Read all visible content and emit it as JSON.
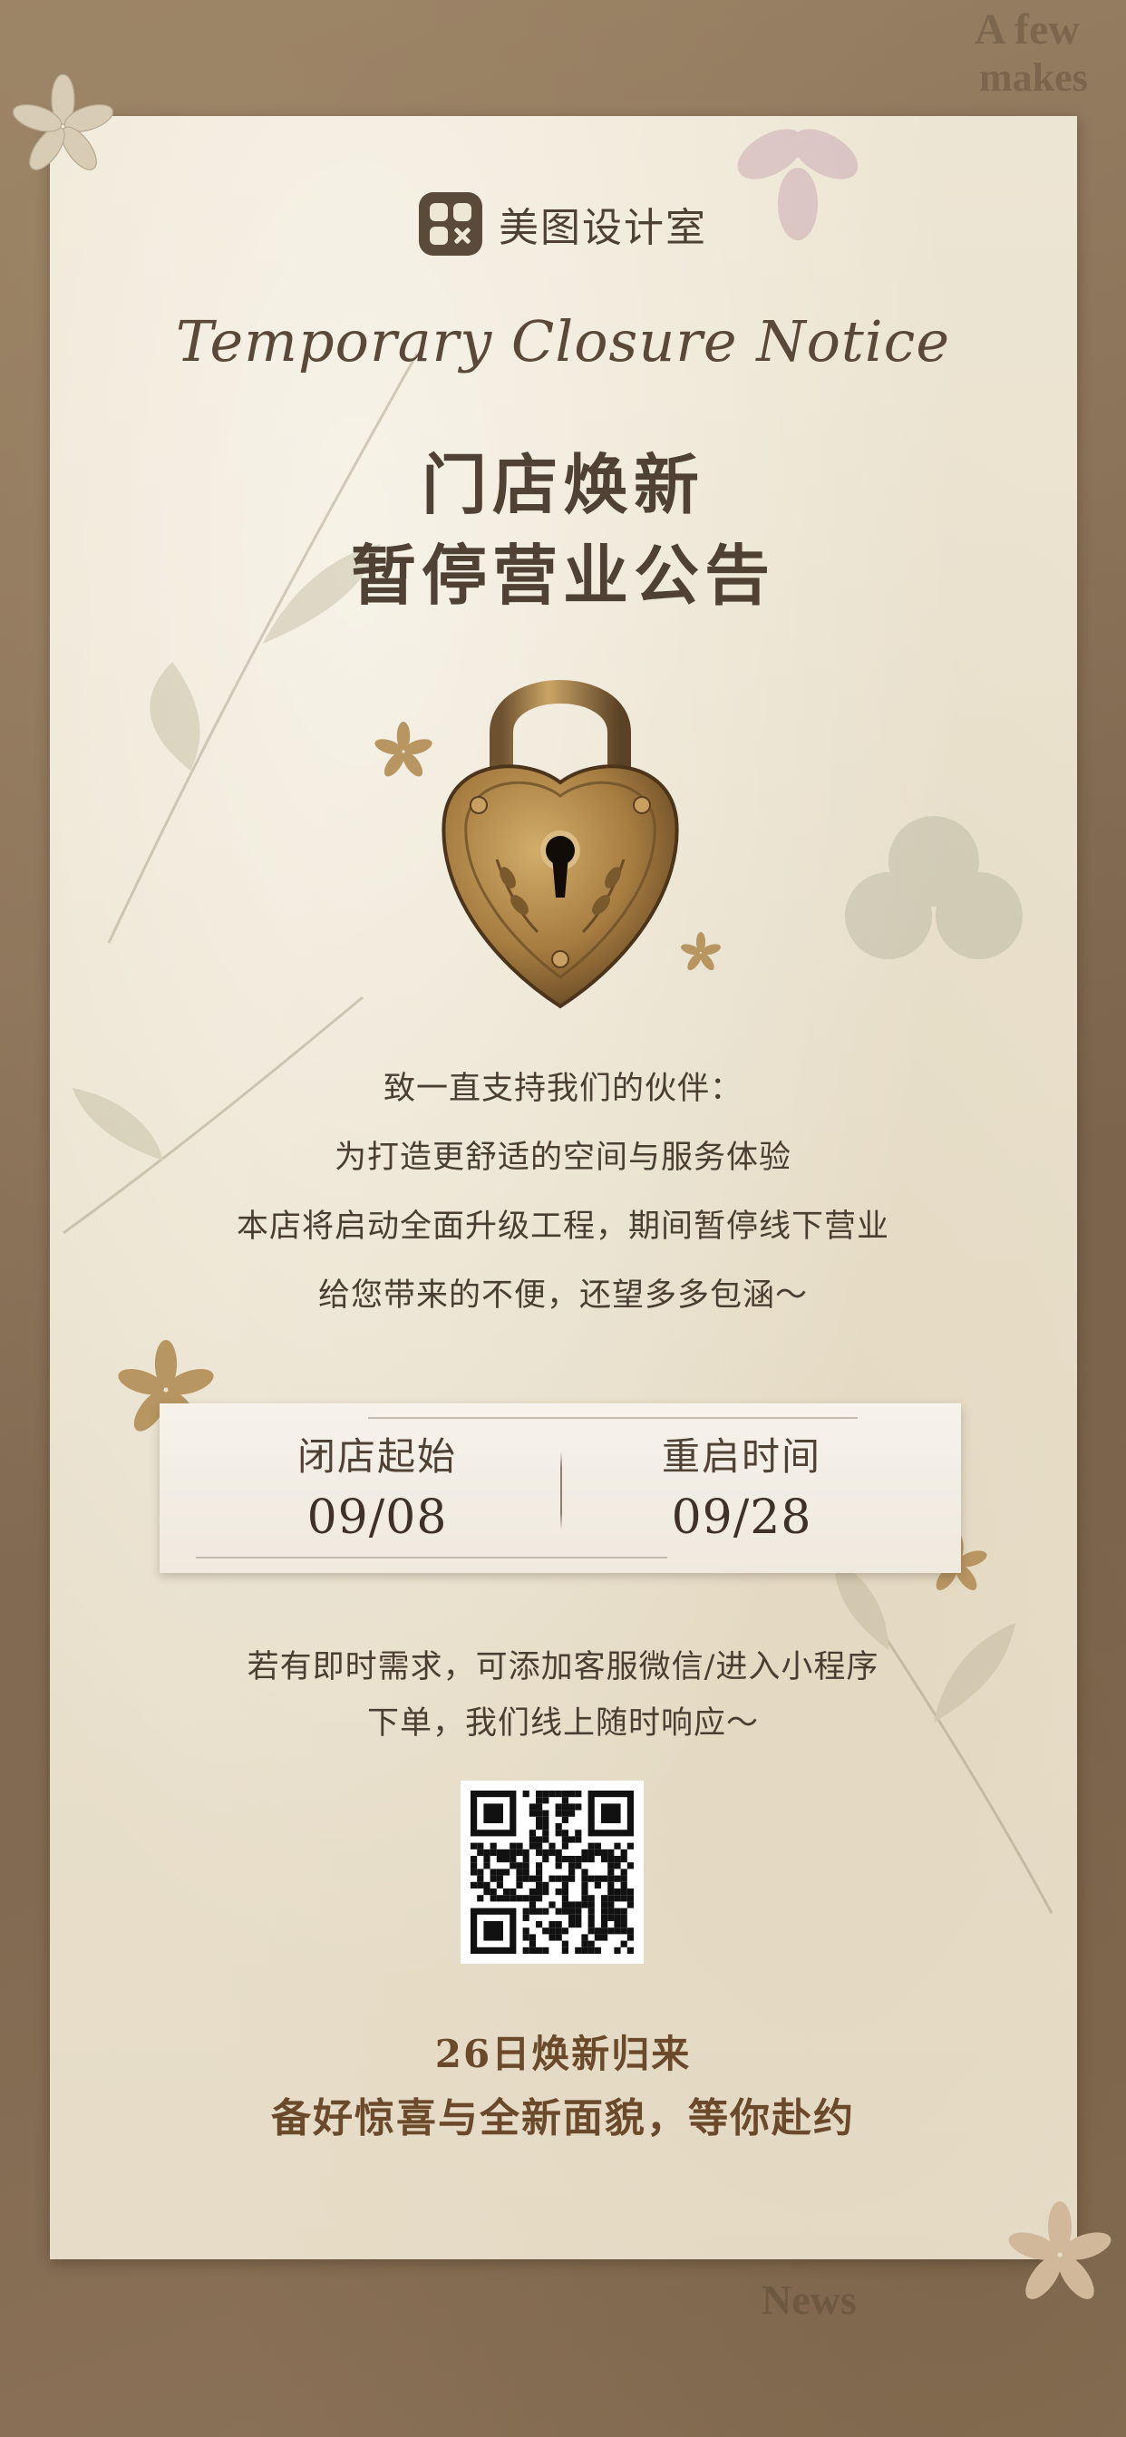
{
  "brand": {
    "name": "美图设计室",
    "logo_icon": "meitu-logo-icon"
  },
  "header": {
    "script_title": "Temporary Closure Notice",
    "title_line1": "门店焕新",
    "title_line2": "暂停营业公告"
  },
  "notice": {
    "line1": "致一直支持我们的伙伴：",
    "line2": "为打造更舒适的空间与服务体验",
    "line3": "本店将启动全面升级工程，期间暂停线下营业",
    "line4": "给您带来的不便，还望多多包涵～"
  },
  "dates": {
    "close_label": "闭店起始",
    "close_value": "09/08",
    "reopen_label": "重启时间",
    "reopen_value": "09/28"
  },
  "contact": {
    "line1": "若有即时需求，可添加客服微信/进入小程序",
    "line2": "下单，我们线上随时响应～"
  },
  "footer": {
    "line1": "26日焕新归来",
    "line2": "备好惊喜与全新面貌，等你赴约"
  },
  "background_text": {
    "top_right": "A few",
    "top_right_2": "makes",
    "bottom": "News"
  },
  "colors": {
    "frame": "#8a7259",
    "paper": "#ebe3d0",
    "text": "#4a3e33",
    "accent": "#6b4a2c",
    "lock_gold": "#b08a4a"
  }
}
